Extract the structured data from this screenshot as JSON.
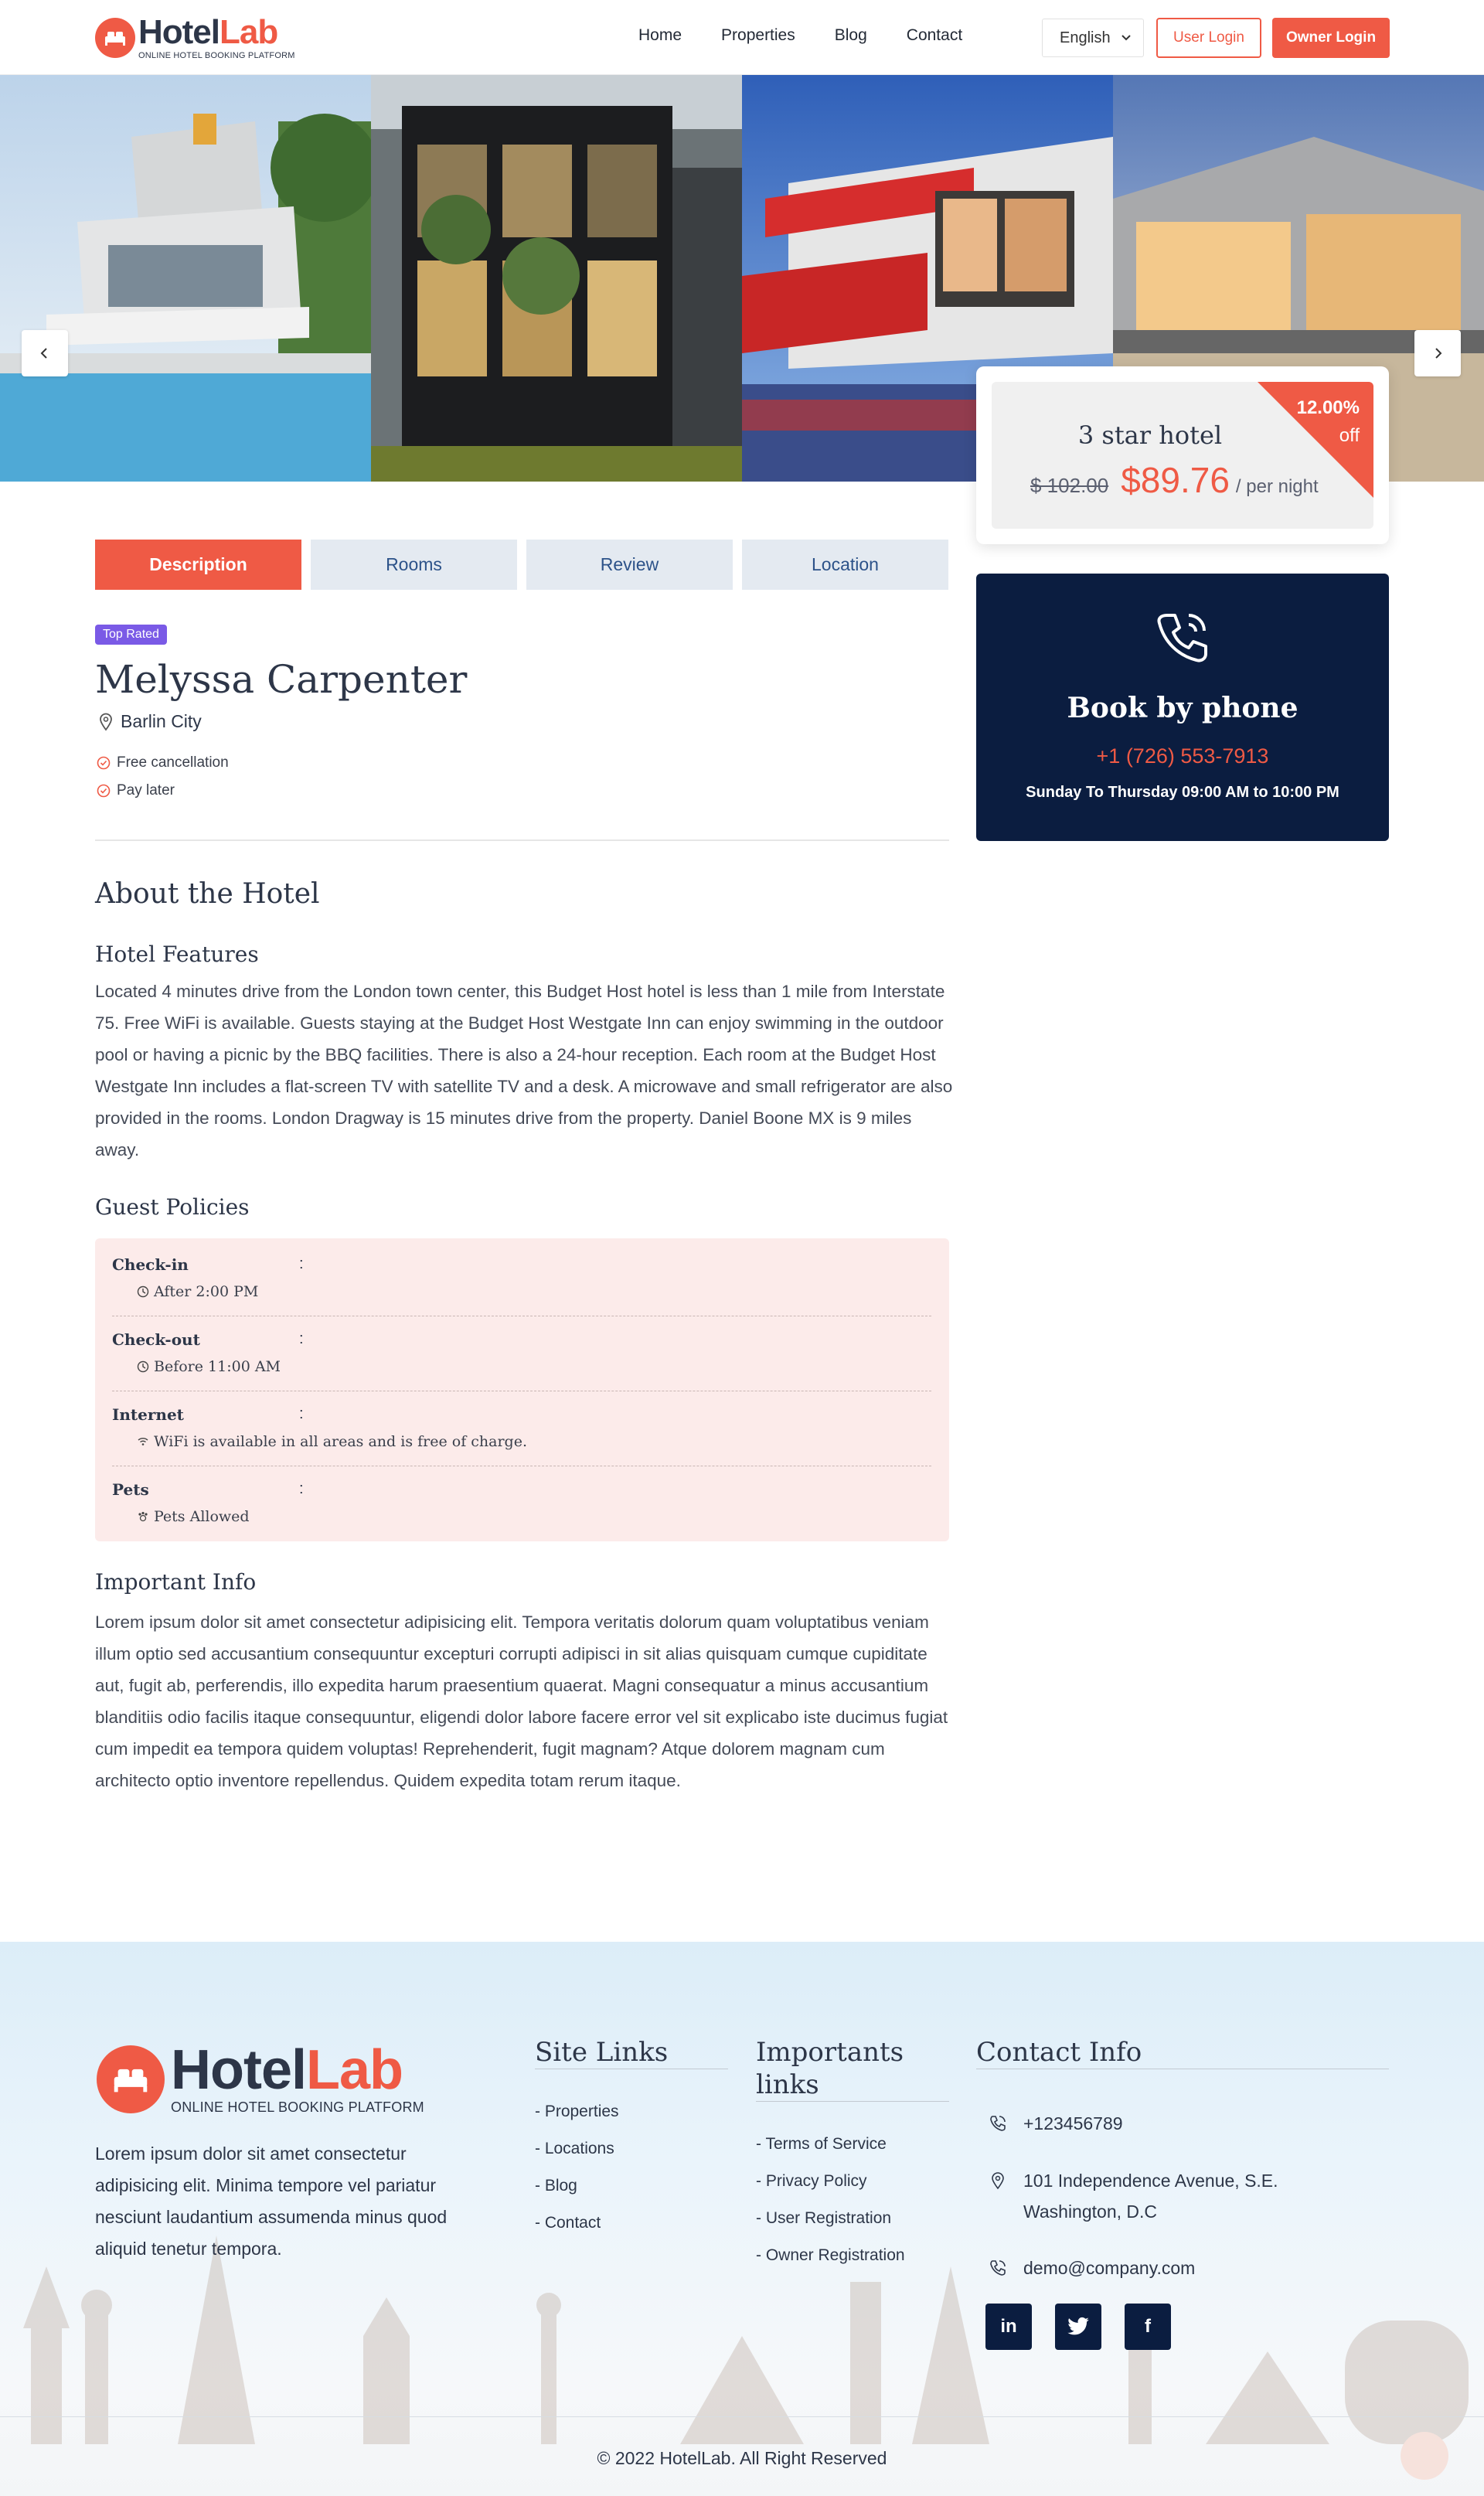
{
  "header": {
    "logo_name_a": "Hotel",
    "logo_name_b": "Lab",
    "logo_tagline": "ONLINE HOTEL BOOKING PLATFORM",
    "nav": [
      "Home",
      "Properties",
      "Blog",
      "Contact"
    ],
    "language": "English",
    "user_login": "User Login",
    "owner_login": "Owner Login"
  },
  "pricing": {
    "stars_label": "3 star hotel",
    "old_price": "$ 102.00",
    "new_price": "$89.76",
    "per_night": "/ per night",
    "discount": "12.00%",
    "discount_suffix": "off"
  },
  "booking": {
    "title": "Book by phone",
    "phone": "+1 (726) 553-7913",
    "hours": "Sunday To Thursday 09:00 AM to 10:00 PM"
  },
  "tabs": [
    "Description",
    "Rooms",
    "Review",
    "Location"
  ],
  "hotel": {
    "badge": "Top Rated",
    "name": "Melyssa Carpenter",
    "location": "Barlin City",
    "features": [
      "Free cancellation",
      "Pay later"
    ]
  },
  "about": {
    "title": "About the Hotel",
    "features_title": "Hotel Features",
    "features_text": "Located 4 minutes drive from the London town center, this Budget Host hotel is less than 1 mile from Interstate 75. Free WiFi is available. Guests staying at the Budget Host Westgate Inn can enjoy swimming in the outdoor pool or having a picnic by the BBQ facilities. There is also a 24-hour reception. Each room at the Budget Host Westgate Inn includes a flat-screen TV with satellite TV and a desk. A microwave and small refrigerator are also provided in the rooms. London Dragway is 15 minutes drive from the property. Daniel Boone MX is 9 miles away.",
    "policies_title": "Guest Policies",
    "policies": [
      {
        "label": "Check-in",
        "value": "After 2:00 PM",
        "icon": "clock-icon"
      },
      {
        "label": "Check-out",
        "value": "Before 11:00 AM",
        "icon": "clock-icon"
      },
      {
        "label": "Internet",
        "value": "WiFi is available in all areas and is free of charge.",
        "icon": "wifi-icon"
      },
      {
        "label": "Pets",
        "value": "Pets Allowed",
        "icon": "paw-icon"
      }
    ],
    "colon": ":",
    "info_title": "Important Info",
    "info_text": "Lorem ipsum dolor sit amet consectetur adipisicing elit. Tempora veritatis dolorum quam voluptatibus veniam illum optio sed accusantium consequuntur excepturi corrupti adipisci in sit alias quisquam cumque cupiditate aut, fugit ab, perferendis, illo expedita harum praesentium quaerat. Magni consequatur a minus accusantium blanditiis odio facilis itaque consequuntur, eligendi dolor labore facere error vel sit explicabo iste ducimus fugiat cum impedit ea tempora quidem voluptas! Reprehenderit, fugit magnam? Atque dolorem magnam cum architecto optio inventore repellendus. Quidem expedita totam rerum itaque."
  },
  "footer": {
    "about_text": "Lorem ipsum dolor sit amet consectetur adipisicing elit. Minima tempore vel pariatur nesciunt laudantium assumenda minus quod aliquid tenetur tempora.",
    "site_links_title": "Site Links",
    "site_links": [
      "- Properties",
      "- Locations",
      "- Blog",
      "- Contact"
    ],
    "important_title_1": "Importants",
    "important_title_2": "links",
    "important_links": [
      "- Terms of Service",
      "- Privacy Policy",
      "- User Registration",
      "- Owner Registration"
    ],
    "contact_title": "Contact Info",
    "phone": "+123456789",
    "address_1": "101 Independence Avenue, S.E.",
    "address_2": "Washington, D.C",
    "email": "demo@company.com",
    "social": [
      "in",
      "twitter",
      "f"
    ],
    "copyright": "© 2022 HotelLab. All Right Reserved"
  },
  "colors": {
    "accent": "#ef5a45",
    "navy": "#0b1d40",
    "tab_bg": "#e4eaf1",
    "policy_bg": "#fcebea",
    "badge": "#7a5ae6"
  }
}
